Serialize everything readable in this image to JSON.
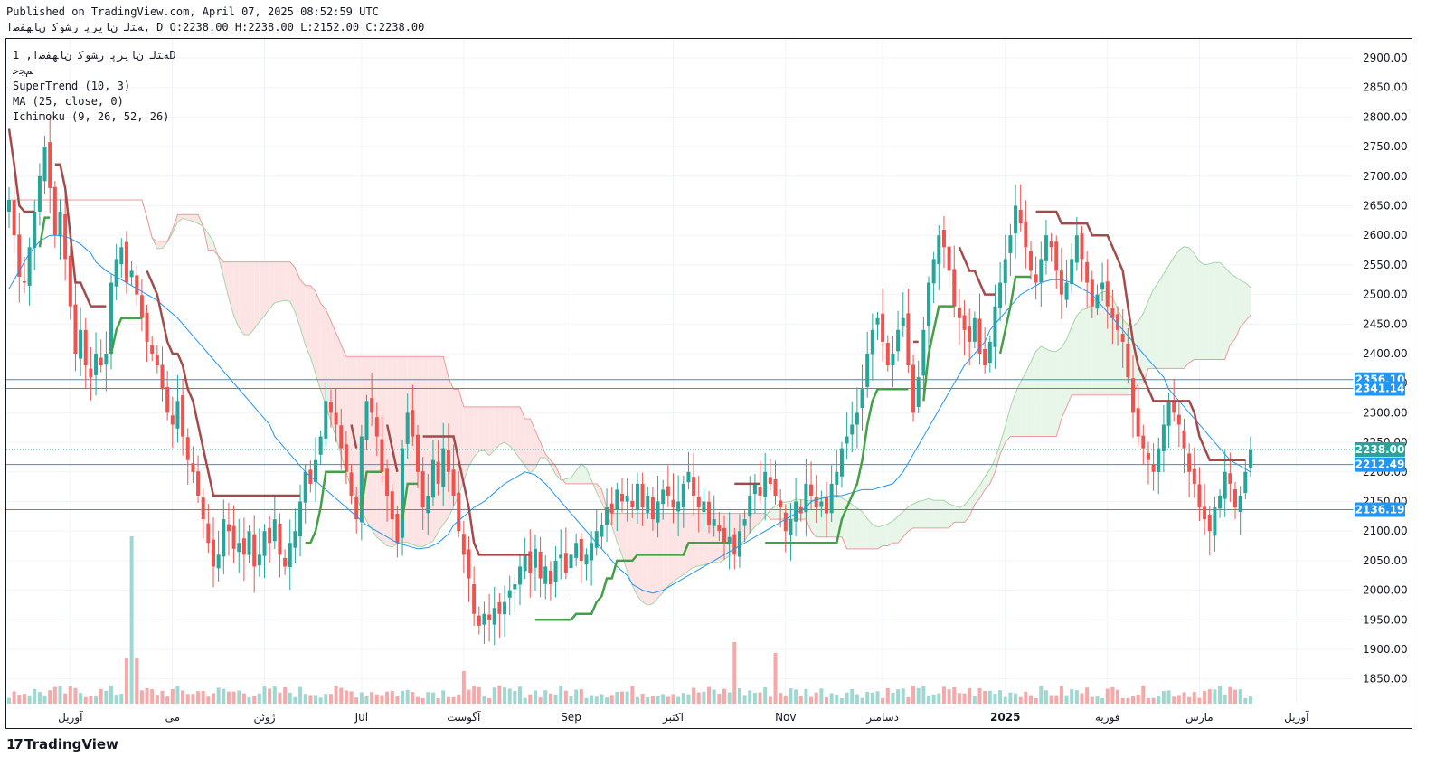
{
  "header": {
    "published": "Published on TradingView.com, April 07, 2025 08:52:59 UTC",
    "ohlc": "ﻪﺘﻟ ﻥﺎﯾﺮﭘ ﺭﺸﻮﮐ ﻥﺎﻬﻔﺻﺍ, D O:2238.00 H:2238.00 L:2152.00 C:2238.00"
  },
  "legend": {
    "symbol": "ﻪﺘﻟ ﻥﺎﯾﺮﭘ ﺭﺸﻮﮐ ﻥﺎﻬﻔﺻﺍ, 1D",
    "exchange": "ﻢﺠﺣ",
    "supertrend": "SuperTrend (10, 3)",
    "ma": "MA (25, close, 0)",
    "ichimoku": "Ichimoku (9, 26, 52, 26)"
  },
  "logo": {
    "text": "TradingView"
  },
  "chart_data": {
    "type": "candlestick",
    "ylim": [
      1800,
      2925
    ],
    "y_ticks": [
      1850,
      1900,
      1950,
      2000,
      2050,
      2100,
      2150,
      2200,
      2250,
      2300,
      2350,
      2400,
      2450,
      2500,
      2550,
      2600,
      2650,
      2700,
      2750,
      2800,
      2850,
      2900
    ],
    "x_labels": [
      {
        "label": "آوریل",
        "bar": 12
      },
      {
        "label": "می",
        "bar": 32
      },
      {
        "label": "ژوئن",
        "bar": 50
      },
      {
        "label": "Jul",
        "bar": 69
      },
      {
        "label": "آگوست",
        "bar": 89
      },
      {
        "label": "Sep",
        "bar": 110
      },
      {
        "label": "اکتبر",
        "bar": 130
      },
      {
        "label": "Nov",
        "bar": 152
      },
      {
        "label": "دسامبر",
        "bar": 171
      },
      {
        "label": "2025",
        "bar": 195
      },
      {
        "label": "فوریه",
        "bar": 215
      },
      {
        "label": "مارس",
        "bar": 233
      },
      {
        "label": "آوریل",
        "bar": 252
      }
    ],
    "price_labels": [
      {
        "value": 2356.1,
        "text": "2356.10",
        "color": "#2196f3"
      },
      {
        "value": 2341.14,
        "text": "2341.14",
        "color": "#2196f3"
      },
      {
        "value": 2238.0,
        "text": "2238.00",
        "color": "#26a69a"
      },
      {
        "value": 2212.49,
        "text": "2212.49",
        "color": "#2196f3"
      },
      {
        "value": 2136.19,
        "text": "2136.19",
        "color": "#2196f3"
      }
    ],
    "horizontal_lines": [
      2356.1,
      2341.14,
      2212.49,
      2136.19
    ],
    "last_price": 2238.0,
    "colors": {
      "up": "#26a69a",
      "down": "#ef5350",
      "ma": "#2196f3",
      "st_up": "#43a047",
      "st_down": "#a44a4a",
      "kumo_up": "#e8f5e9",
      "kumo_down": "#fde4e4"
    },
    "closes": [
      2660,
      2600,
      2530,
      2520,
      2580,
      2640,
      2700,
      2750,
      2680,
      2600,
      2640,
      2560,
      2480,
      2400,
      2440,
      2380,
      2360,
      2400,
      2380,
      2400,
      2520,
      2560,
      2580,
      2520,
      2540,
      2500,
      2460,
      2420,
      2400,
      2380,
      2340,
      2300,
      2280,
      2320,
      2260,
      2220,
      2200,
      2160,
      2120,
      2080,
      2040,
      2060,
      2120,
      2100,
      2070,
      2080,
      2060,
      2100,
      2040,
      2060,
      2100,
      2080,
      2120,
      2060,
      2040,
      2080,
      2100,
      2150,
      2200,
      2180,
      2220,
      2260,
      2320,
      2300,
      2280,
      2240,
      2200,
      2160,
      2120,
      2260,
      2320,
      2300,
      2260,
      2200,
      2160,
      2120,
      2080,
      2240,
      2300,
      2260,
      2200,
      2140,
      2160,
      2220,
      2180,
      2240,
      2200,
      2160,
      2100,
      2060,
      2020,
      1960,
      1940,
      1960,
      1950,
      1970,
      1960,
      1980,
      2000,
      2010,
      2040,
      2060,
      2030,
      2070,
      2020,
      2040,
      2010,
      2050,
      2060,
      2030,
      2060,
      2080,
      2050,
      2060,
      2080,
      2100,
      2110,
      2140,
      2130,
      2170,
      2150,
      2160,
      2140,
      2180,
      2140,
      2160,
      2120,
      2150,
      2170,
      2160,
      2140,
      2150,
      2180,
      2200,
      2160,
      2140,
      2150,
      2110,
      2120,
      2100,
      2080,
      2090,
      2060,
      2100,
      2120,
      2160,
      2180,
      2160,
      2200,
      2180,
      2160,
      2140,
      2100,
      2120,
      2150,
      2130,
      2180,
      2160,
      2140,
      2150,
      2130,
      2180,
      2200,
      2240,
      2260,
      2280,
      2300,
      2340,
      2400,
      2440,
      2460,
      2420,
      2380,
      2400,
      2440,
      2460,
      2380,
      2300,
      2360,
      2440,
      2520,
      2560,
      2600,
      2580,
      2540,
      2480,
      2460,
      2440,
      2420,
      2460,
      2400,
      2380,
      2420,
      2480,
      2520,
      2560,
      2600,
      2650,
      2620,
      2580,
      2540,
      2520,
      2560,
      2600,
      2580,
      2540,
      2500,
      2520,
      2560,
      2600,
      2560,
      2520,
      2480,
      2500,
      2520,
      2480,
      2460,
      2440,
      2420,
      2360,
      2300,
      2260,
      2240,
      2220,
      2200,
      2240,
      2280,
      2320,
      2300,
      2280,
      2240,
      2200,
      2180,
      2140,
      2120,
      2100,
      2140,
      2160,
      2200,
      2180,
      2140,
      2160,
      2200,
      2238
    ],
    "ma_series": [
      2510,
      2540,
      2570,
      2590,
      2600,
      2600,
      2595,
      2585,
      2570,
      2555,
      2540,
      2530,
      2520,
      2510,
      2500,
      2490,
      2475,
      2460,
      2440,
      2420,
      2400,
      2380,
      2360,
      2340,
      2320,
      2300,
      2280,
      2260,
      2240,
      2220,
      2200,
      2185,
      2170,
      2155,
      2140,
      2125,
      2110,
      2100,
      2090,
      2080,
      2075,
      2070,
      2072,
      2080,
      2095,
      2110,
      2125,
      2140,
      2150,
      2165,
      2180,
      2190,
      2200,
      2195,
      2180,
      2160,
      2140,
      2120,
      2100,
      2080,
      2060,
      2040,
      2025,
      2010,
      2000,
      1995,
      2000,
      2010,
      2020,
      2030,
      2040,
      2050,
      2060,
      2070,
      2080,
      2090,
      2100,
      2110,
      2120,
      2130,
      2140,
      2150,
      2155,
      2160,
      2160,
      2165,
      2170,
      2170,
      2175,
      2180,
      2200,
      2230,
      2260,
      2290,
      2320,
      2350,
      2380,
      2400,
      2420,
      2440,
      2460,
      2480,
      2500,
      2510,
      2520,
      2525,
      2525,
      2520,
      2510,
      2500,
      2480,
      2460,
      2440,
      2420,
      2400,
      2380,
      2360,
      2340,
      2320,
      2300,
      2280,
      2260,
      2240,
      2220,
      2210,
      2200
    ]
  }
}
